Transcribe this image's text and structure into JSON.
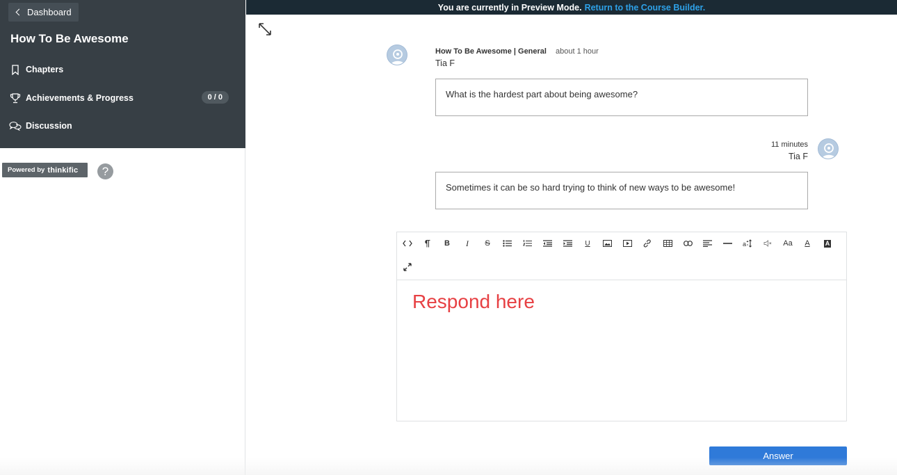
{
  "sidebar": {
    "back_label": "Dashboard",
    "course_title": "How To Be Awesome",
    "items": [
      {
        "label": "Chapters",
        "icon": "bookmark-icon"
      },
      {
        "label": "Achievements & Progress",
        "icon": "trophy-icon",
        "badge": "0 / 0"
      },
      {
        "label": "Discussion",
        "icon": "chat-bubbles-icon"
      }
    ],
    "powered_prefix": "Powered by",
    "powered_brand": "thinkific",
    "help_label": "?"
  },
  "preview_bar": {
    "text": "You are currently in Preview Mode.",
    "link": "Return to the Course Builder."
  },
  "posts": [
    {
      "forum": "How To Be Awesome | General",
      "time": "about 1 hour",
      "author": "Tia F",
      "body": "What is the hardest part about being awesome?"
    },
    {
      "time": "11 minutes",
      "author": "Tia F",
      "body": "Sometimes it can be so hard trying to think of new ways to be awesome!"
    }
  ],
  "editor": {
    "placeholder_overlay": "Respond here",
    "toolbar_icons": [
      "code-view-icon",
      "paragraph-icon",
      "bold-icon",
      "italic-icon",
      "strikethrough-icon",
      "bullet-list-icon",
      "numbered-list-icon",
      "outdent-icon",
      "indent-icon",
      "underline-icon",
      "image-icon",
      "video-icon",
      "link-icon",
      "table-icon",
      "unlink-icon",
      "align-icon",
      "horizontal-rule-icon",
      "font-size-icon",
      "audio-icon",
      "font-family-icon",
      "text-color-icon",
      "background-color-icon",
      "fullscreen-icon"
    ]
  },
  "answer_label": "Answer",
  "colors": {
    "sidebar_bg": "#373f45",
    "preview_bar_bg": "#1b2a34",
    "link": "#2ea1e8",
    "primary_button": "#2f7ad9",
    "respond_text": "#e74043"
  }
}
